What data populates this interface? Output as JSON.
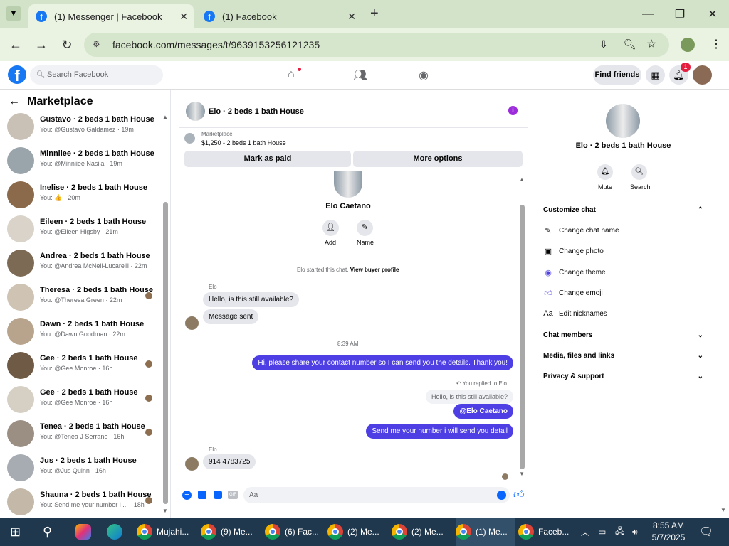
{
  "browser": {
    "tabs": [
      {
        "title": "(1) Messenger | Facebook",
        "active": true
      },
      {
        "title": "(1) Facebook",
        "active": false
      }
    ],
    "new_tab": "+",
    "url": "facebook.com/messages/t/9639153256121235"
  },
  "fb": {
    "search_placeholder": "Search Facebook",
    "find_friends": "Find friends",
    "notification_count": "1"
  },
  "left": {
    "title": "Marketplace",
    "chats": [
      {
        "name": "Gustavo · 2 beds 1 bath House",
        "sub": "You: @Gustavo Galdamez · 19m",
        "thumb": "#c9c1b6",
        "seen": false
      },
      {
        "name": "Minniiee · 2 beds 1 bath House",
        "sub": "You: @Minniiee Nasiia · 19m",
        "thumb": "#9aa5ab",
        "seen": false
      },
      {
        "name": "Inelise · 2 beds 1 bath House",
        "sub": "You: 👍 · 20m",
        "thumb": "#8a6a4a",
        "seen": false
      },
      {
        "name": "Eileen · 2 beds 1 bath House",
        "sub": "You: @Eileen Higsby · 21m",
        "thumb": "#d9d3c9",
        "seen": false
      },
      {
        "name": "Andrea · 2 beds 1 bath House",
        "sub": "You: @Andrea McNeil-Lucarelli · 22m",
        "thumb": "#7d6a55",
        "seen": false
      },
      {
        "name": "Theresa · 2 beds 1 bath House",
        "sub": "You: @Theresa Green · 22m",
        "thumb": "#cfc4b3",
        "seen": true
      },
      {
        "name": "Dawn · 2 beds 1 bath House",
        "sub": "You: @Dawn Goodman · 22m",
        "thumb": "#b8a48c",
        "seen": false
      },
      {
        "name": "Gee · 2 beds 1 bath House",
        "sub": "You: @Gee Monroe · 16h",
        "thumb": "#6e5a45",
        "seen": true
      },
      {
        "name": "Gee · 2 beds 1 bath House",
        "sub": "You: @Gee Monroe · 16h",
        "thumb": "#d6d0c4",
        "seen": true
      },
      {
        "name": "Tenea · 2 beds 1 bath House",
        "sub": "You: @Tenea J Serrano · 16h",
        "thumb": "#9b8f84",
        "seen": true
      },
      {
        "name": "Jus · 2 beds 1 bath House",
        "sub": "You: @Jus Quinn · 16h",
        "thumb": "#a7acb2",
        "seen": false
      },
      {
        "name": "Shauna · 2 beds 1 bath House",
        "sub": "You: Send me your number i ... · 18h",
        "thumb": "#c4b9a8",
        "seen": true
      }
    ]
  },
  "conversation": {
    "title": "Elo · 2 beds 1 bath House",
    "listing_label": "Marketplace",
    "listing_price": "$1,250 - 2 beds 1 bath House",
    "mark_paid": "Mark as paid",
    "more_options": "More options",
    "profile_name": "Elo Caetano",
    "add_label": "Add",
    "name_label": "Name",
    "started_text": "Elo started this chat.",
    "view_profile": "View buyer profile",
    "sender1": "Elo",
    "msg1": "Hello, is this still available?",
    "msg2": "Message sent",
    "time": "8:39 AM",
    "msg3": "Hi, please share your contact number so I can send you the details. Thank you!",
    "replied_label": "You replied to Elo",
    "quoted": "Hello, is this still available?",
    "msg4": "@Elo Caetano",
    "msg5": "Send me your number i will send you detail",
    "sender2": "Elo",
    "msg6": "914 4783725",
    "composer_placeholder": "Aa"
  },
  "details": {
    "title": "Elo · 2 beds 1 bath House",
    "mute": "Mute",
    "search": "Search",
    "customize": "Customize chat",
    "change_name": "Change chat name",
    "change_photo": "Change photo",
    "change_theme": "Change theme",
    "change_emoji": "Change emoji",
    "edit_nicknames": "Edit nicknames",
    "chat_members": "Chat members",
    "media": "Media, files and links",
    "privacy": "Privacy & support"
  },
  "taskbar": {
    "items": [
      "Mujahi...",
      "(9) Me...",
      "(6) Fac...",
      "(2) Me...",
      "(2) Me...",
      "(1) Me...",
      "Faceb..."
    ],
    "time": "8:55 AM",
    "date": "5/7/2025"
  },
  "colors": {
    "accent": "#4d3fe3",
    "fb_blue": "#1877f2",
    "tab_green": "#d3e3c9"
  }
}
